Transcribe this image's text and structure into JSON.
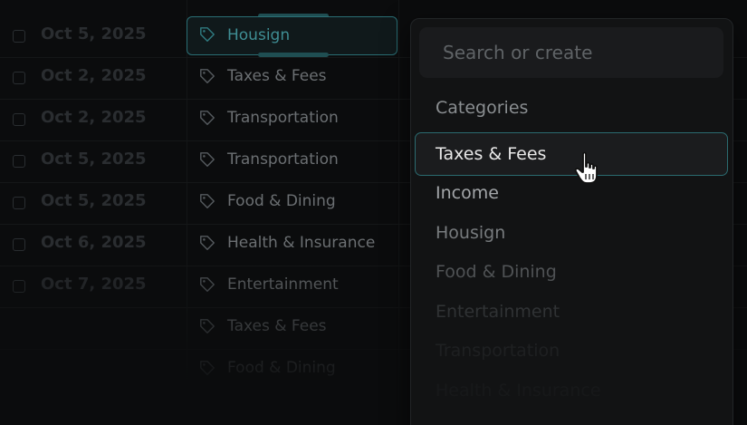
{
  "table": {
    "rows": [
      {
        "date": "Oct 5, 2025",
        "category": "Housign"
      },
      {
        "date": "Oct 2, 2025",
        "category": "Taxes & Fees"
      },
      {
        "date": "Oct 2, 2025",
        "category": "Transportation"
      },
      {
        "date": "Oct 5, 2025",
        "category": "Transportation"
      },
      {
        "date": "Oct 5, 2025",
        "category": "Food & Dining"
      },
      {
        "date": "Oct 6, 2025",
        "category": "Health & Insurance"
      },
      {
        "date": "Oct 7, 2025",
        "category": "Entertainment"
      },
      {
        "date": "",
        "category": "Taxes & Fees"
      },
      {
        "date": "",
        "category": "Food & Dining"
      }
    ]
  },
  "dropdown": {
    "search_placeholder": "Search or create",
    "section_label": "Categories",
    "options": [
      "Taxes & Fees",
      "Income",
      "Housign",
      "Food & Dining",
      "Entertainment",
      "Transportation",
      "Health & Insurance"
    ],
    "highlighted_index": 0
  },
  "colors": {
    "accent": "#2b6b70",
    "background": "#0b0c0d",
    "dropdown_bg": "#121314"
  }
}
